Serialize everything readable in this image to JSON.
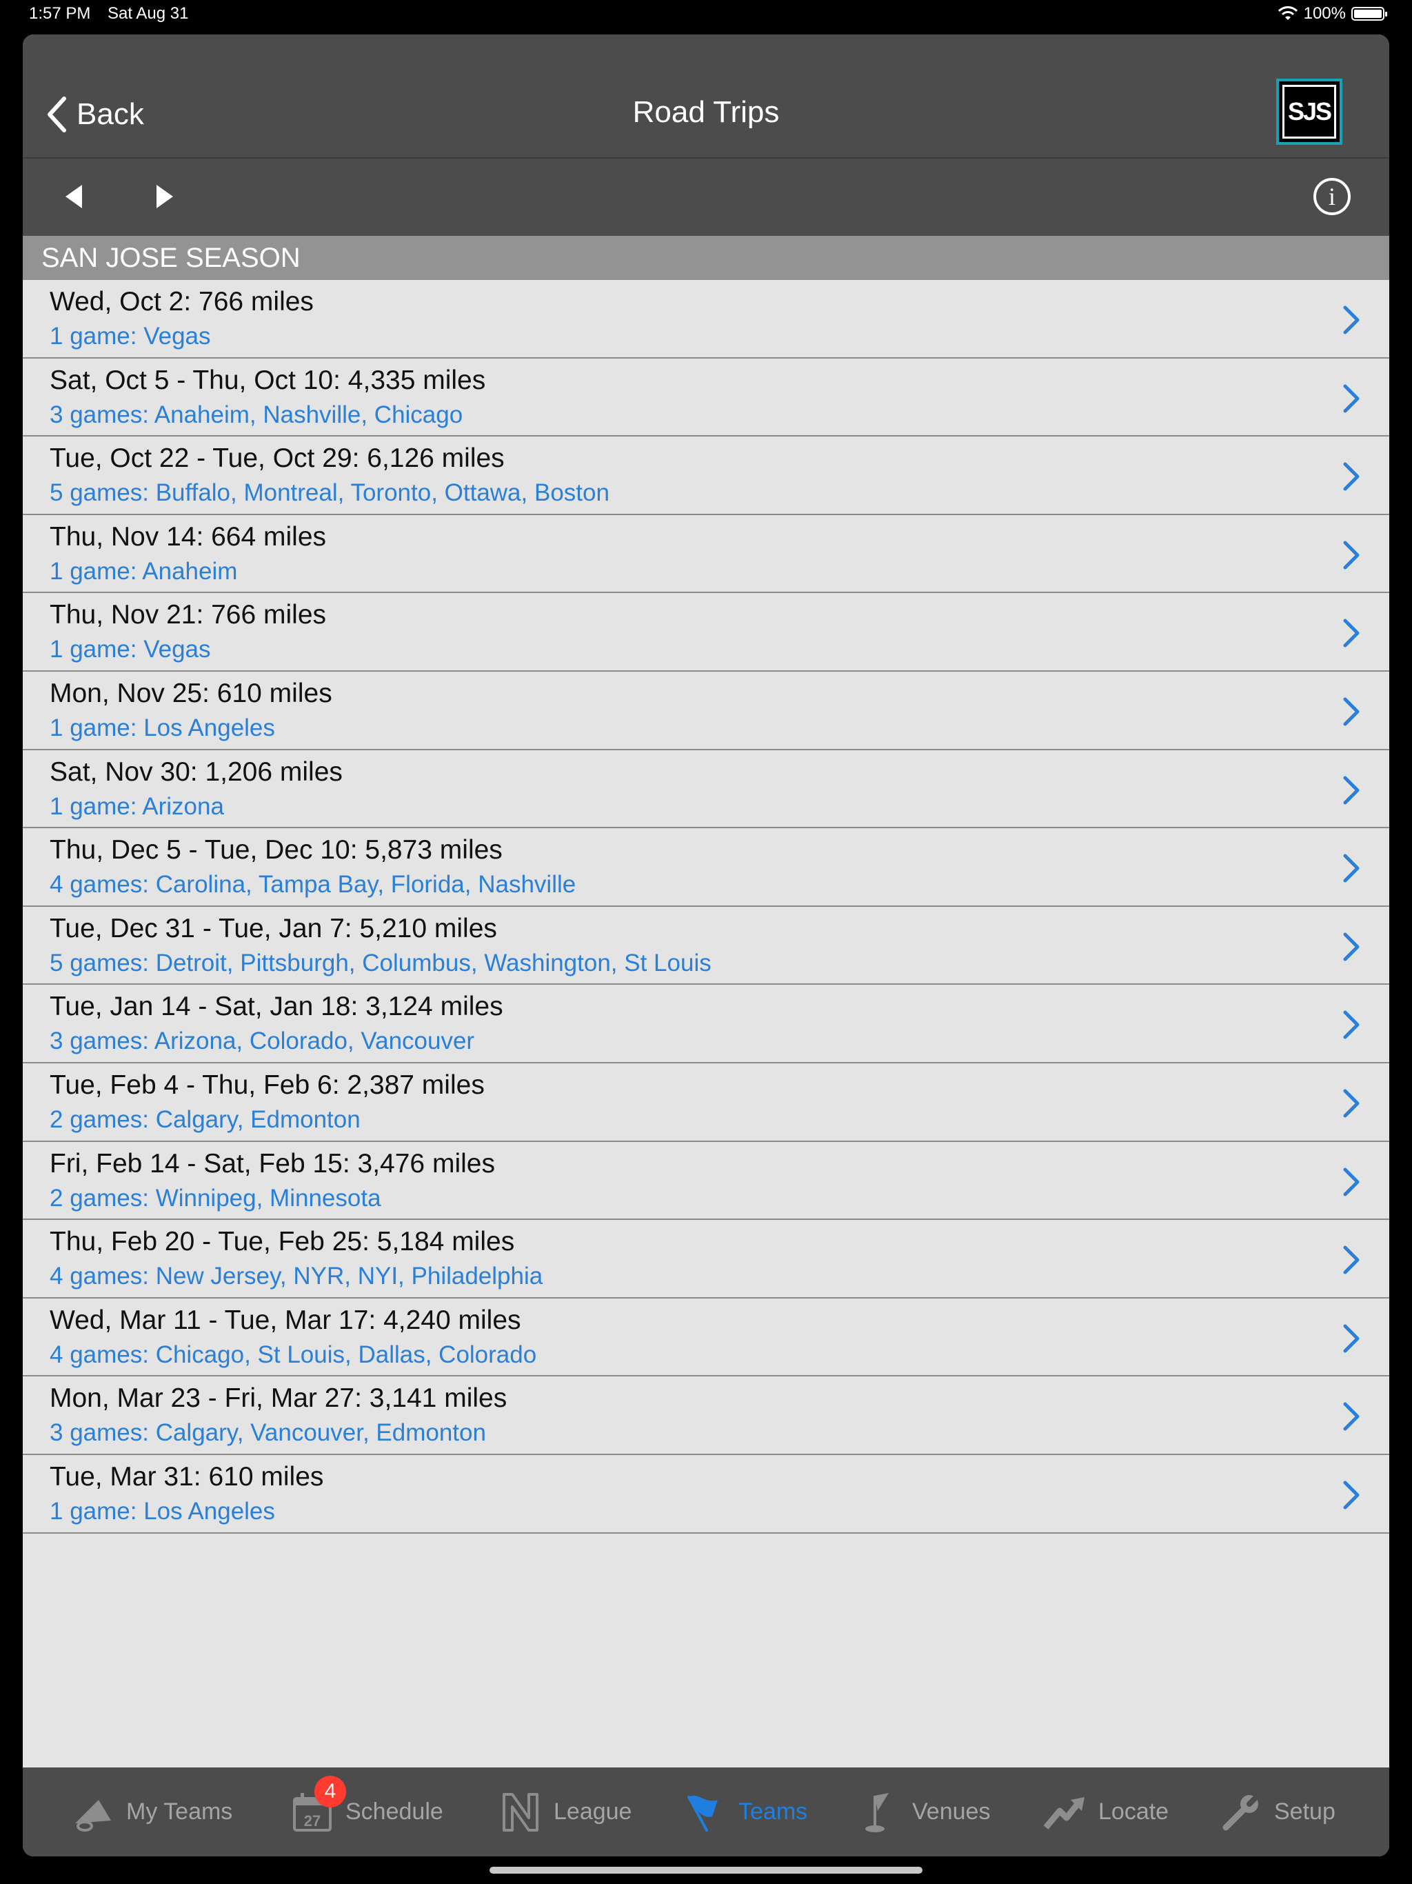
{
  "status_bar": {
    "time": "1:57 PM",
    "date": "Sat Aug 31",
    "battery": "100%"
  },
  "nav": {
    "back_label": "Back",
    "title": "Road Trips",
    "logo_text": "SJS"
  },
  "section_header": "SAN JOSE SEASON",
  "trips": [
    {
      "title": "Wed, Oct 2:  766 miles",
      "subtitle": "1 game:  Vegas"
    },
    {
      "title": "Sat, Oct 5 - Thu, Oct 10:  4,335 miles",
      "subtitle": "3 games:  Anaheim,  Nashville,  Chicago"
    },
    {
      "title": "Tue, Oct 22 - Tue, Oct 29:  6,126 miles",
      "subtitle": "5 games:  Buffalo,  Montreal,  Toronto,  Ottawa,  Boston"
    },
    {
      "title": "Thu, Nov 14:  664 miles",
      "subtitle": "1 game:  Anaheim"
    },
    {
      "title": "Thu, Nov 21:  766 miles",
      "subtitle": "1 game:  Vegas"
    },
    {
      "title": "Mon, Nov 25:  610 miles",
      "subtitle": "1 game:  Los Angeles"
    },
    {
      "title": "Sat, Nov 30:  1,206 miles",
      "subtitle": "1 game:  Arizona"
    },
    {
      "title": "Thu, Dec 5 - Tue, Dec 10:  5,873 miles",
      "subtitle": "4 games:  Carolina,  Tampa Bay,  Florida,  Nashville"
    },
    {
      "title": "Tue, Dec 31 - Tue, Jan 7:  5,210 miles",
      "subtitle": "5 games:  Detroit,  Pittsburgh,  Columbus,  Washington,  St Louis"
    },
    {
      "title": "Tue, Jan 14 - Sat, Jan 18:  3,124 miles",
      "subtitle": "3 games:  Arizona,  Colorado,  Vancouver"
    },
    {
      "title": "Tue, Feb 4 - Thu, Feb 6:  2,387 miles",
      "subtitle": "2 games:  Calgary,  Edmonton"
    },
    {
      "title": "Fri, Feb 14 - Sat, Feb 15:  3,476 miles",
      "subtitle": "2 games:  Winnipeg,  Minnesota"
    },
    {
      "title": "Thu, Feb 20 - Tue, Feb 25:  5,184 miles",
      "subtitle": "4 games:  New Jersey,  NYR,  NYI,  Philadelphia"
    },
    {
      "title": "Wed, Mar 11 - Tue, Mar 17:  4,240 miles",
      "subtitle": "4 games:  Chicago,  St Louis,  Dallas,  Colorado"
    },
    {
      "title": "Mon, Mar 23 - Fri, Mar 27:  3,141 miles",
      "subtitle": "3 games:  Calgary,  Vancouver,  Edmonton"
    },
    {
      "title": "Tue, Mar 31:  610 miles",
      "subtitle": "1 game:  Los Angeles"
    }
  ],
  "tabs": {
    "my_teams": "My Teams",
    "schedule": "Schedule",
    "schedule_badge": "4",
    "schedule_icon_day": "27",
    "league": "League",
    "teams": "Teams",
    "venues": "Venues",
    "locate": "Locate",
    "setup": "Setup"
  },
  "colors": {
    "accent": "#1f7fe0",
    "link": "#2a7fd8",
    "bar": "#4c4c4c",
    "badge": "#ff3b30"
  }
}
